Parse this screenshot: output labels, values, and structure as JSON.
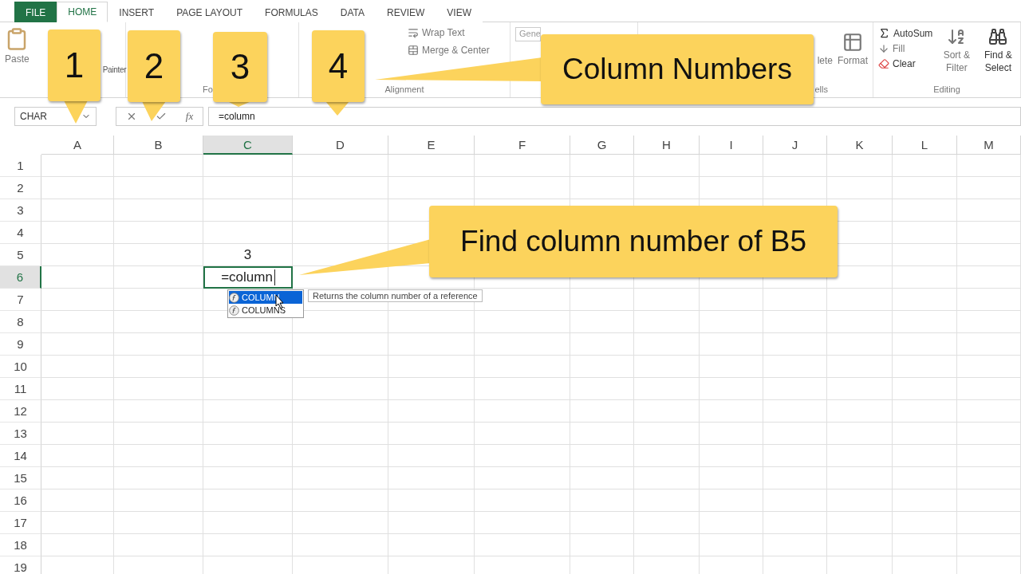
{
  "tabs": [
    {
      "label": "FILE",
      "kind": "file",
      "selected": false
    },
    {
      "label": "HOME",
      "kind": "tab",
      "selected": true
    },
    {
      "label": "INSERT",
      "kind": "tab",
      "selected": false
    },
    {
      "label": "PAGE LAYOUT",
      "kind": "tab",
      "selected": false
    },
    {
      "label": "FORMULAS",
      "kind": "tab",
      "selected": false
    },
    {
      "label": "DATA",
      "kind": "tab",
      "selected": false
    },
    {
      "label": "REVIEW",
      "kind": "tab",
      "selected": false
    },
    {
      "label": "VIEW",
      "kind": "tab",
      "selected": false
    }
  ],
  "ribbon": {
    "paste": "Paste",
    "format_painter": "Painter",
    "font_label": "Fo",
    "wrap_text": "Wrap Text",
    "merge_center": "Merge & Center",
    "alignment_label": "Alignment",
    "number_format": "Gene",
    "delete": "lete",
    "format": "Format",
    "cells_label": "ells",
    "autosum": "AutoSum",
    "fill": "Fill",
    "clear": "Clear",
    "sort_filter": "Sort & Filter",
    "find_select": "Find & Select",
    "editing_label": "Editing"
  },
  "formula_bar": {
    "name_box": "CHAR",
    "insert_function": "fx",
    "formula": "=column"
  },
  "sheet": {
    "columns": [
      {
        "label": "A",
        "selected": false
      },
      {
        "label": "B",
        "selected": false
      },
      {
        "label": "C",
        "selected": true
      },
      {
        "label": "D",
        "selected": false
      },
      {
        "label": "E",
        "selected": false
      },
      {
        "label": "F",
        "selected": false
      },
      {
        "label": "G",
        "selected": false
      },
      {
        "label": "H",
        "selected": false
      },
      {
        "label": "I",
        "selected": false
      },
      {
        "label": "J",
        "selected": false
      },
      {
        "label": "K",
        "selected": false
      },
      {
        "label": "L",
        "selected": false
      },
      {
        "label": "M",
        "selected": false
      }
    ],
    "rows": [
      {
        "label": "1",
        "selected": false
      },
      {
        "label": "2",
        "selected": false
      },
      {
        "label": "3",
        "selected": false
      },
      {
        "label": "4",
        "selected": false
      },
      {
        "label": "5",
        "selected": false,
        "cells": [
          null,
          null,
          {
            "value": "3",
            "editing": false
          }
        ]
      },
      {
        "label": "6",
        "selected": true,
        "cells": [
          null,
          null,
          {
            "value": "=column",
            "editing": true
          }
        ]
      },
      {
        "label": "7",
        "selected": false
      },
      {
        "label": "8",
        "selected": false
      },
      {
        "label": "9",
        "selected": false
      },
      {
        "label": "10",
        "selected": false
      },
      {
        "label": "11",
        "selected": false
      },
      {
        "label": "12",
        "selected": false
      },
      {
        "label": "13",
        "selected": false
      },
      {
        "label": "14",
        "selected": false
      },
      {
        "label": "15",
        "selected": false
      },
      {
        "label": "16",
        "selected": false
      },
      {
        "label": "17",
        "selected": false
      },
      {
        "label": "18",
        "selected": false
      },
      {
        "label": "19",
        "selected": false
      }
    ]
  },
  "autocomplete": {
    "items": [
      {
        "label": "COLUMN",
        "selected": true
      },
      {
        "label": "COLUMNS",
        "selected": false
      }
    ],
    "tooltip": "Returns the column number of a reference"
  },
  "callouts": [
    {
      "text": "1",
      "kind": "number"
    },
    {
      "text": "2",
      "kind": "number"
    },
    {
      "text": "3",
      "kind": "number"
    },
    {
      "text": "4",
      "kind": "number"
    },
    {
      "text": "Column Numbers",
      "kind": "label"
    },
    {
      "text": "Find column number of B5",
      "kind": "label"
    }
  ]
}
